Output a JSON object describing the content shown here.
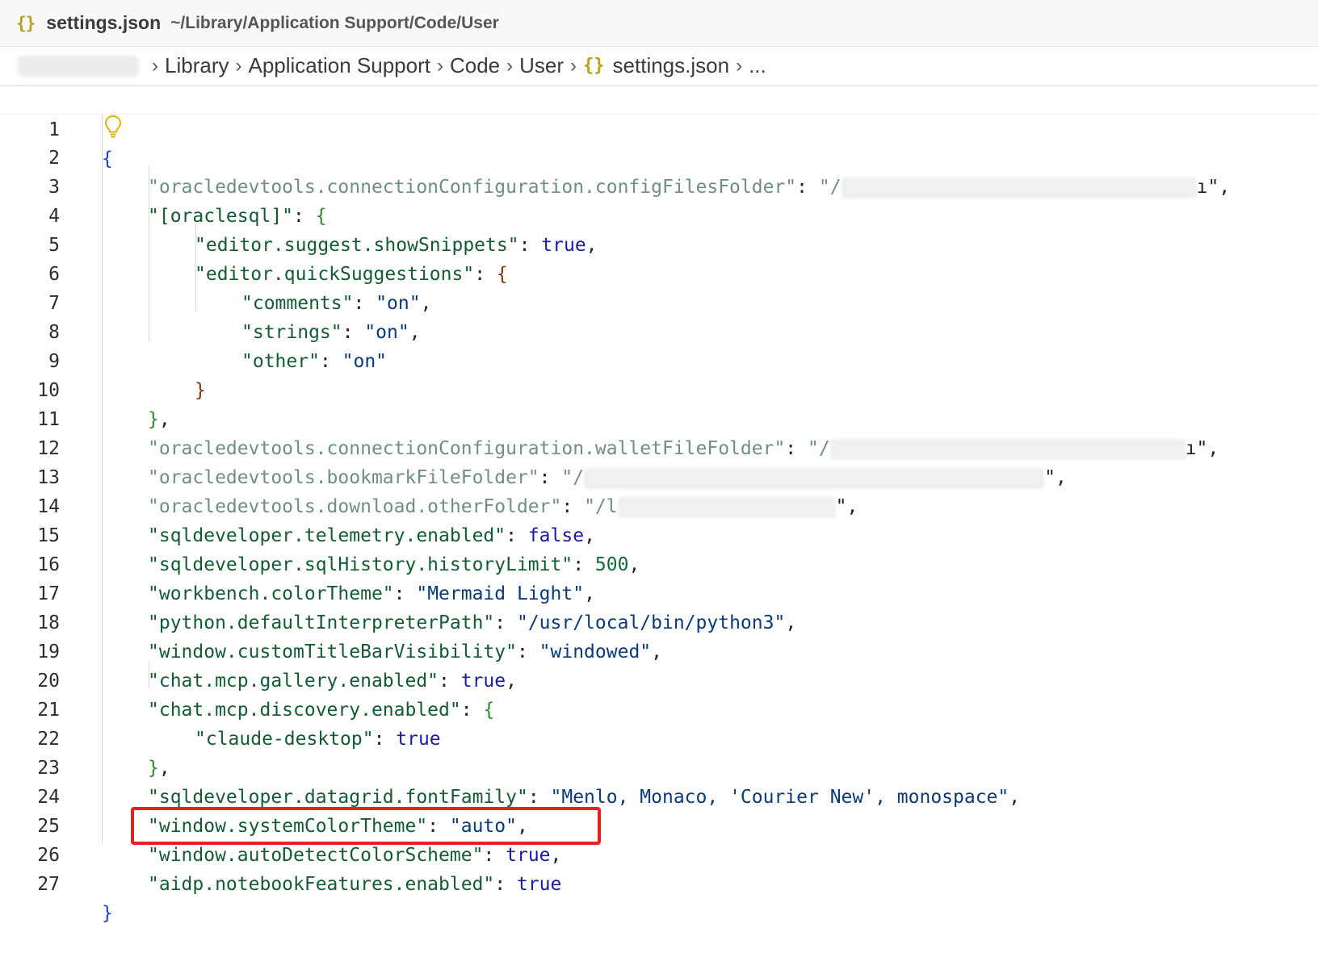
{
  "window": {
    "file_icon": "{}",
    "file_name": "settings.json",
    "file_path": "~/Library/Application Support/Code/User"
  },
  "breadcrumb": {
    "items": [
      "Library",
      "Application Support",
      "Code",
      "User"
    ],
    "file_icon": "{}",
    "file": "settings.json",
    "more": "..."
  },
  "editor": {
    "lines": [
      {
        "n": "1"
      },
      {
        "n": "2"
      },
      {
        "n": "3"
      },
      {
        "n": "4"
      },
      {
        "n": "5"
      },
      {
        "n": "6"
      },
      {
        "n": "7"
      },
      {
        "n": "8"
      },
      {
        "n": "9"
      },
      {
        "n": "10"
      },
      {
        "n": "11"
      },
      {
        "n": "12"
      },
      {
        "n": "13"
      },
      {
        "n": "14"
      },
      {
        "n": "15"
      },
      {
        "n": "16"
      },
      {
        "n": "17"
      },
      {
        "n": "18"
      },
      {
        "n": "19"
      },
      {
        "n": "20"
      },
      {
        "n": "21"
      },
      {
        "n": "22"
      },
      {
        "n": "23"
      },
      {
        "n": "24"
      },
      {
        "n": "25"
      },
      {
        "n": "26"
      },
      {
        "n": "27"
      }
    ],
    "tokens": {
      "l2_key": "\"oracledevtools.connectionConfiguration.configFilesFolder\"",
      "l2_val_start": "\"/",
      "l2_val_end": "ı\",",
      "l3_key": "\"[oraclesql]\"",
      "l4_key": "\"editor.suggest.showSnippets\"",
      "l4_val": "true",
      "l5_key": "\"editor.quickSuggestions\"",
      "l6_key": "\"comments\"",
      "l6_val": "\"on\"",
      "l7_key": "\"strings\"",
      "l7_val": "\"on\"",
      "l8_key": "\"other\"",
      "l8_val": "\"on\"",
      "l11_key": "\"oracledevtools.connectionConfiguration.walletFileFolder\"",
      "l11_val_start": "\"/",
      "l11_val_end": "ı\",",
      "l12_key": "\"oracledevtools.bookmarkFileFolder\"",
      "l12_val_start": "\"/",
      "l12_val_end": "\",",
      "l13_key": "\"oracledevtools.download.otherFolder\"",
      "l13_val_start": "\"/l",
      "l13_val_end": "\",",
      "l14_key": "\"sqldeveloper.telemetry.enabled\"",
      "l14_val": "false",
      "l15_key": "\"sqldeveloper.sqlHistory.historyLimit\"",
      "l15_val": "500",
      "l16_key": "\"workbench.colorTheme\"",
      "l16_val": "\"Mermaid Light\"",
      "l17_key": "\"python.defaultInterpreterPath\"",
      "l17_val": "\"/usr/local/bin/python3\"",
      "l18_key": "\"window.customTitleBarVisibility\"",
      "l18_val": "\"windowed\"",
      "l19_key": "\"chat.mcp.gallery.enabled\"",
      "l19_val": "true",
      "l20_key": "\"chat.mcp.discovery.enabled\"",
      "l21_key": "\"claude-desktop\"",
      "l21_val": "true",
      "l23_key": "\"sqldeveloper.datagrid.fontFamily\"",
      "l23_val": "\"Menlo, Monaco, 'Courier New', monospace\"",
      "l24_key": "\"window.systemColorTheme\"",
      "l24_val": "\"auto\"",
      "l25_key": "\"window.autoDetectColorScheme\"",
      "l25_val": "true",
      "l26_key": "\"aidp.notebookFeatures.enabled\"",
      "l26_val": "true"
    }
  },
  "colors": {
    "highlight_box": "#e8211f",
    "json_icon": "#b5a31c",
    "lightbulb": "#d9b500"
  },
  "icons": {
    "lightbulb": "lightbulb-icon",
    "file": "json-file-icon",
    "chevron": "chevron-right-icon"
  }
}
